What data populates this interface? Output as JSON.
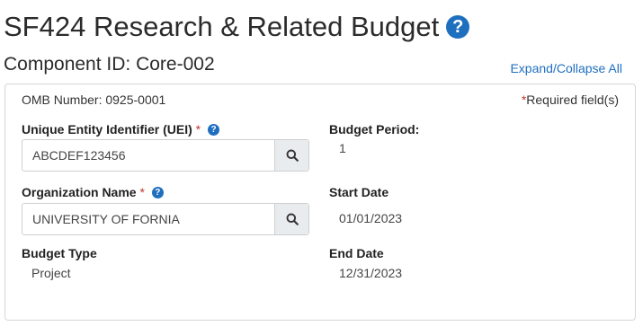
{
  "header": {
    "title": "SF424 Research & Related Budget",
    "help_icon_glyph": "?",
    "component_id": "Component ID: Core-002",
    "expand_collapse_label": "Expand/Collapse All"
  },
  "panel": {
    "omb_number": "OMB Number: 0925-0001",
    "required_star": "*",
    "required_text": "Required field(s)"
  },
  "form": {
    "uei": {
      "label": "Unique Entity Identifier (UEI)",
      "required_star": "*",
      "value": "ABCDEF123456"
    },
    "org_name": {
      "label": "Organization Name",
      "required_star": "*",
      "value": "UNIVERSITY OF FORNIA"
    },
    "budget_type": {
      "label": "Budget Type",
      "value": "Project"
    },
    "budget_period": {
      "label": "Budget Period:",
      "value": "1"
    },
    "start_date": {
      "label": "Start Date",
      "value": "01/01/2023"
    },
    "end_date": {
      "label": "End Date",
      "value": "12/31/2023"
    }
  },
  "colors": {
    "accent": "#1f6fbf",
    "required": "#c0392b",
    "border": "#d6d6d6"
  }
}
